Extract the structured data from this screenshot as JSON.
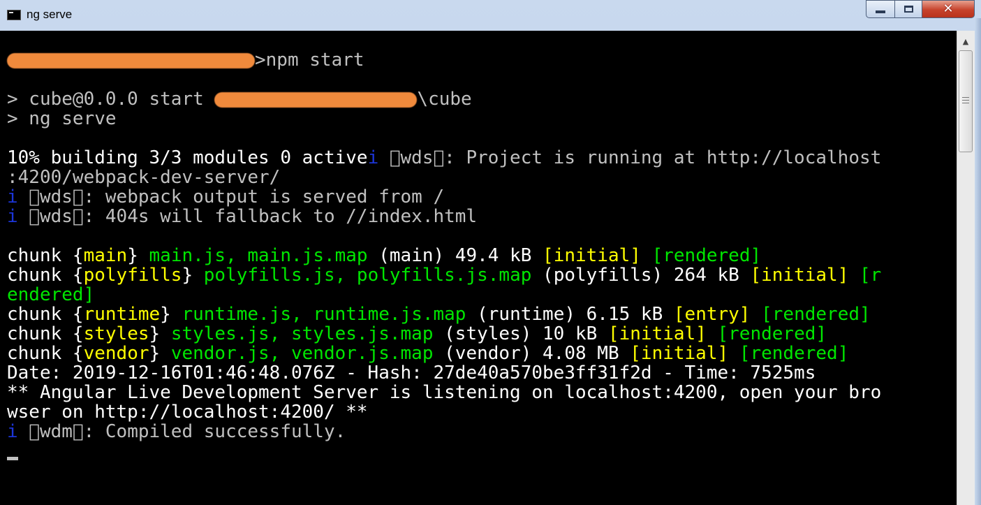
{
  "window": {
    "title": "ng serve",
    "controls": {
      "minimize": "minimize",
      "maximize": "maximize",
      "close": "✕"
    }
  },
  "console": {
    "prompt": ">npm start",
    "start_prefix": "> cube@0.0.0 start ",
    "start_suffix": "\\cube",
    "ng_serve": "> ng serve",
    "building": "10% building 3/3 modules 0 active",
    "info_icon": "i",
    "wds_tag": " \u0000wds\u0000",
    "wdm_tag": " \u0000wdm\u0000",
    "project_running": ": Project is running at http://localhost",
    "project_running_cont": ":4200/webpack-dev-server/",
    "webpack_output": ": webpack output is served from /",
    "fallback": ": 404s will fallback to //index.html",
    "chunk_word": "chunk ",
    "chunks": [
      {
        "name": "main",
        "files": "main.js, main.js.map",
        "info": " (main) 49.4 kB ",
        "flag": "[initial]",
        "status": "[rendered]"
      },
      {
        "name": "polyfills",
        "files": "polyfills.js, polyfills.js.map",
        "info": " (polyfills) 264 kB ",
        "flag": "[initial]",
        "status_part1": "[r",
        "status_part2": "endered]"
      },
      {
        "name": "runtime",
        "files": "runtime.js, runtime.js.map",
        "info": " (runtime) 6.15 kB ",
        "flag": "[entry]",
        "status": "[rendered]"
      },
      {
        "name": "styles",
        "files": "styles.js, styles.js.map",
        "info": " (styles) 10 kB ",
        "flag": "[initial]",
        "status": "[rendered]"
      },
      {
        "name": "vendor",
        "files": "vendor.js, vendor.js.map",
        "info": " (vendor) 4.08 MB ",
        "flag": "[initial]",
        "status": "[rendered]"
      }
    ],
    "date_line": "Date: 2019-12-16T01:46:48.076Z - Hash: 27de40a570be3ff31f2d - Time: 7525ms",
    "server_line1": "** Angular Live Development Server is listening on localhost:4200, open your bro",
    "server_line2": "wser on http://localhost:4200/ **",
    "compiled": ": Compiled successfully."
  }
}
